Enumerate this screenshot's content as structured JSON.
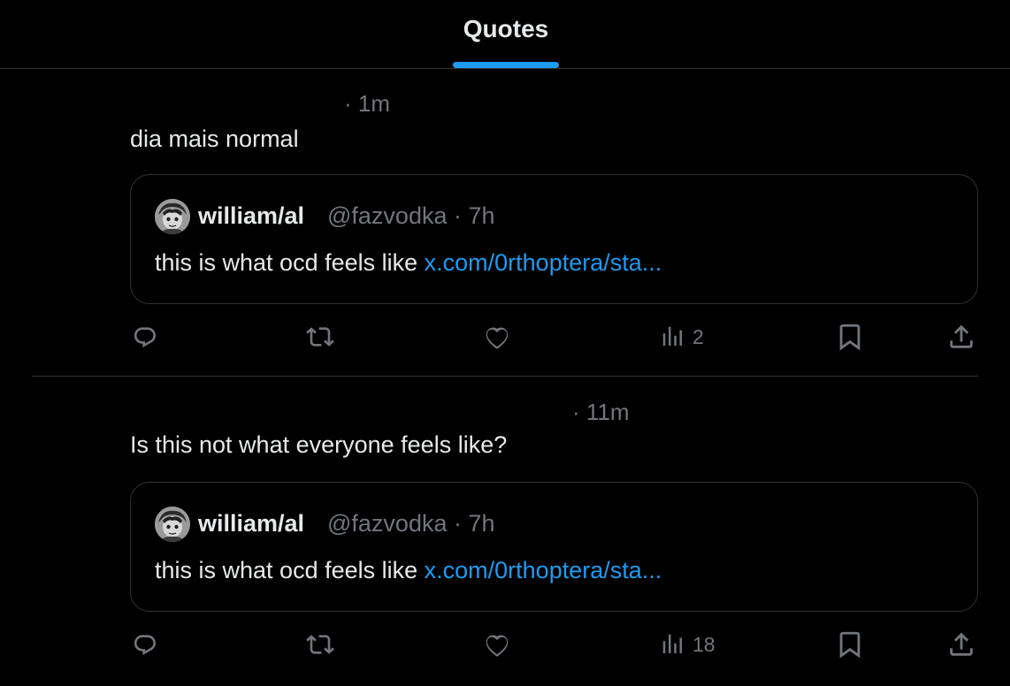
{
  "header": {
    "tab_label": "Quotes",
    "accent": "#1d9bf0"
  },
  "posts": [
    {
      "time": "· 1m",
      "text": "dia mais normal",
      "quote": {
        "author_name": "william/al",
        "author_handle": "@fazvodka · 7h",
        "text": "this is what ocd feels like ",
        "link": "x.com/0rthoptera/sta..."
      },
      "actions": {
        "reply_icon": "reply-icon",
        "repost_icon": "repost-icon",
        "like_icon": "like-icon",
        "views_icon": "views-icon",
        "views_count": "2",
        "bookmark_icon": "bookmark-icon",
        "share_icon": "share-icon"
      }
    },
    {
      "time": "· 11m",
      "text": "Is this not what everyone feels like?",
      "quote": {
        "author_name": "william/al",
        "author_handle": "@fazvodka · 7h",
        "text": "this is what ocd feels like ",
        "link": "x.com/0rthoptera/sta..."
      },
      "actions": {
        "reply_icon": "reply-icon",
        "repost_icon": "repost-icon",
        "like_icon": "like-icon",
        "views_icon": "views-icon",
        "views_count": "18",
        "bookmark_icon": "bookmark-icon",
        "share_icon": "share-icon"
      }
    }
  ],
  "colors": {
    "background": "#000000",
    "text_primary": "#e7e9ea",
    "text_secondary": "#71767b",
    "border": "#2f3336",
    "link": "#1d9bf0"
  }
}
